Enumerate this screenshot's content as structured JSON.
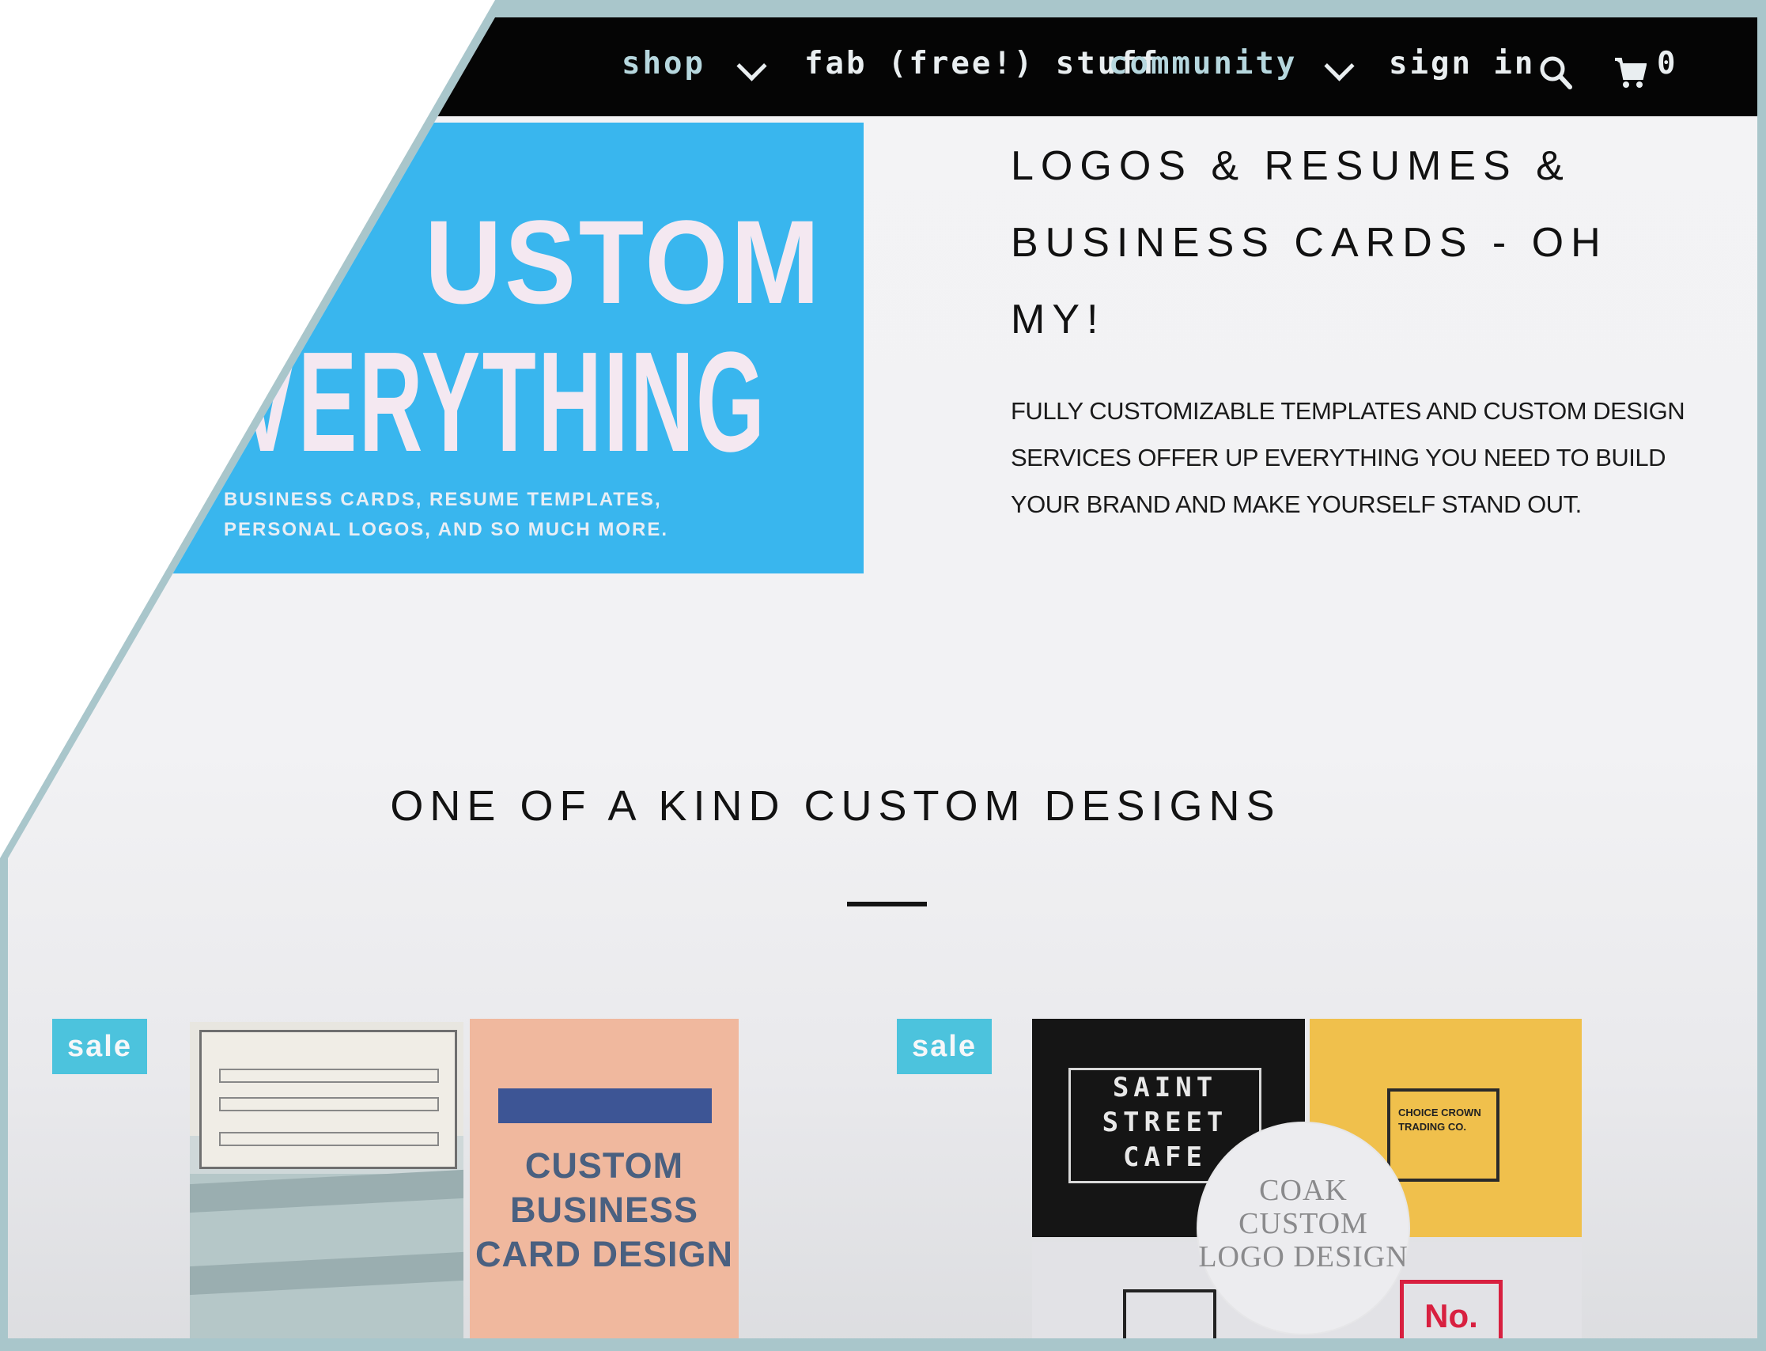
{
  "nav": {
    "items": [
      {
        "label": "shop",
        "dropdown": true
      },
      {
        "label": "fab (free!) stuff",
        "dropdown": false
      },
      {
        "label": "community",
        "dropdown": true
      },
      {
        "label": "sign in",
        "dropdown": false
      }
    ],
    "search_icon": "search-icon",
    "cart_icon": "cart-icon",
    "cart_count": "0"
  },
  "hero": {
    "image_line1": "USTOM",
    "image_line2": "VERYTHING",
    "image_sub": "BUSINESS CARDS,  RESUME TEMPLATES, PERSONAL LOGOS, AND SO MUCH MORE.",
    "title": "LOGOS & RESUMES & BUSINESS CARDS - OH MY!",
    "description": "FULLY CUSTOMIZABLE TEMPLATES AND CUSTOM DESIGN SERVICES OFFER UP EVERYTHING YOU NEED TO BUILD YOUR BRAND AND MAKE YOURSELF STAND OUT."
  },
  "section": {
    "title": "ONE OF A KIND CUSTOM DESIGNS"
  },
  "products": [
    {
      "badge": "sale",
      "thumb_text": "CUSTOM BUSINESS CARD DESIGN"
    },
    {
      "badge": "sale",
      "black_card_text": "SAINT STREET CAFE",
      "yellow_card_text": "CHOICE CROWN TRADING CO.",
      "seal_text": "COAK CUSTOM LOGO DESIGN",
      "red_card_text": "No."
    }
  ],
  "colors": {
    "nav_bg": "#050505",
    "hero_blue": "#39b6ee",
    "sale_badge": "#4cc3dd",
    "accent_pink": "#f0b89e",
    "accent_yellow": "#f0c04c"
  }
}
